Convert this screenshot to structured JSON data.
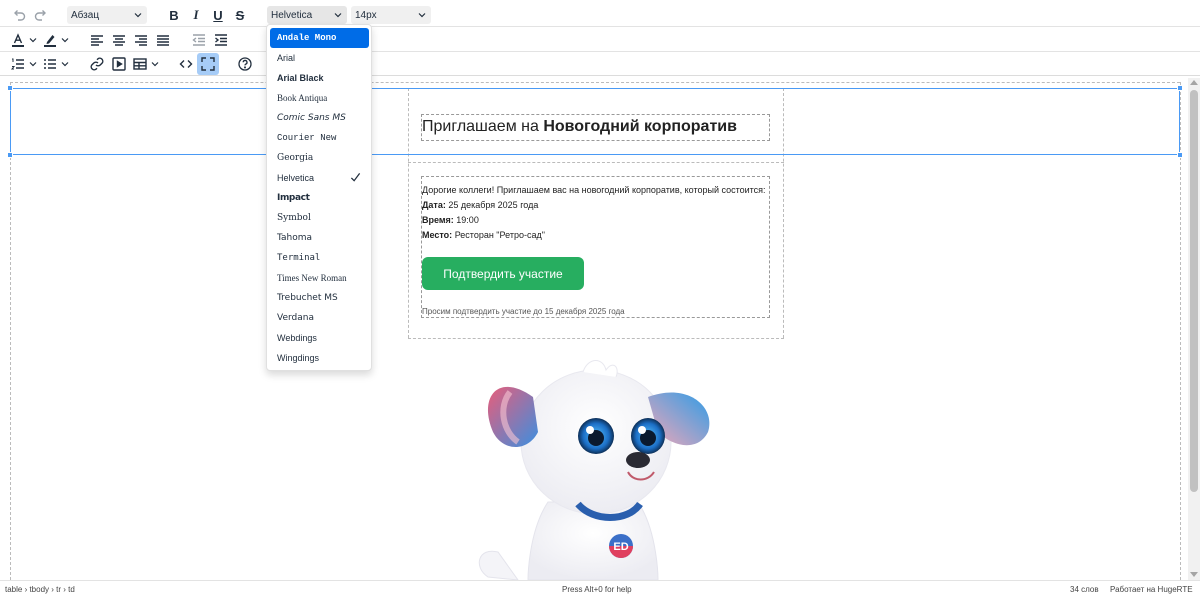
{
  "toolbar": {
    "block_format": "Абзац",
    "font_family": "Helvetica",
    "font_size": "14px",
    "bold_label": "B",
    "italic_label": "I",
    "underline_label": "U",
    "strike_label": "S",
    "fullscreen_active": true
  },
  "font_menu": {
    "items": [
      {
        "label": "Andale Mono",
        "highlighted": true
      },
      {
        "label": "Arial"
      },
      {
        "label": "Arial Black"
      },
      {
        "label": "Book Antiqua"
      },
      {
        "label": "Comic Sans MS"
      },
      {
        "label": "Courier New"
      },
      {
        "label": "Georgia"
      },
      {
        "label": "Helvetica",
        "checked": true
      },
      {
        "label": "Impact"
      },
      {
        "label": "Symbol"
      },
      {
        "label": "Tahoma"
      },
      {
        "label": "Terminal"
      },
      {
        "label": "Times New Roman"
      },
      {
        "label": "Trebuchet MS"
      },
      {
        "label": "Verdana"
      },
      {
        "label": "Webdings"
      },
      {
        "label": "Wingdings"
      }
    ]
  },
  "content": {
    "title_prefix": "Приглашаем на ",
    "title_bold": "Новогодний корпоратив",
    "intro": "Дорогие коллеги! Приглашаем вас на новогодний корпоратив, который состоится:",
    "date_label": "Дата:",
    "date_value": " 25 декабря 2025 года",
    "time_label": "Время:",
    "time_value": " 19:00",
    "place_label": "Место:",
    "place_value": " Ресторан \"Ретро-сад\"",
    "button_label": "Подтвердить участие",
    "note": "Просим подтвердить участие до 15 декабря 2025 года",
    "badge_text": "ED"
  },
  "statusbar": {
    "path": "table › tbody › tr › td",
    "help": "Press Alt+0 for help",
    "word_count": "34 слов",
    "powered": "Работает на HugeRTE"
  },
  "colors": {
    "accent": "#006ce7",
    "selection": "#4a9af5",
    "button_green": "#27ae60",
    "fullscreen_bg": "#a6ccf7"
  }
}
